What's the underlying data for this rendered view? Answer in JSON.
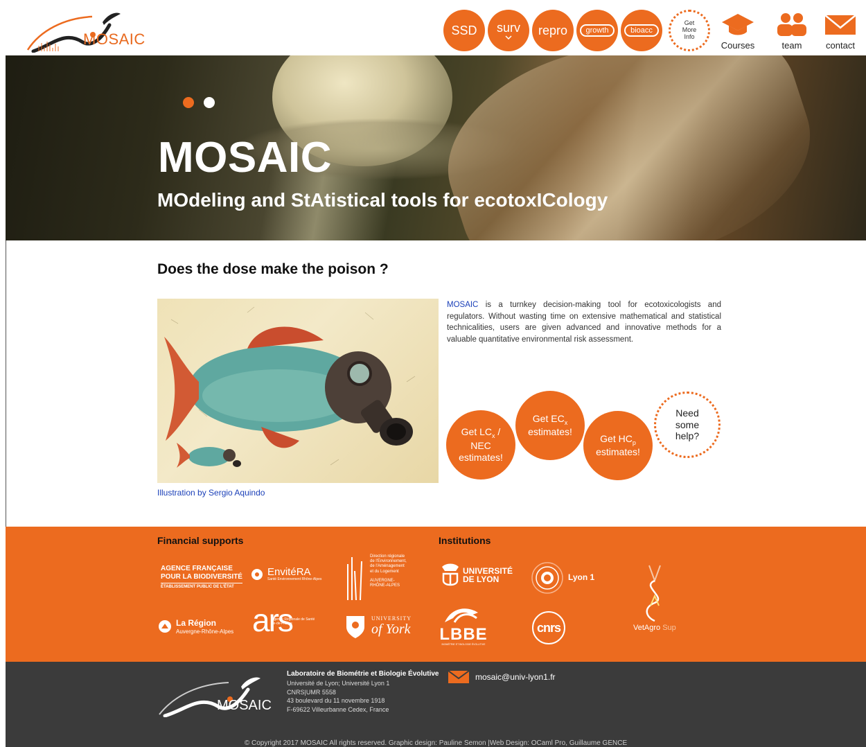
{
  "brand": {
    "logo_text": "MOSAIC",
    "accent_color": "#ec6b1f",
    "logo_icon": "mosaic-logo"
  },
  "nav": {
    "items": [
      {
        "label": "SSD"
      },
      {
        "label": "surv"
      },
      {
        "label": "repro"
      },
      {
        "label": "growth"
      },
      {
        "label": "bioacc"
      }
    ],
    "get_more_info": "Get More Info",
    "courses": {
      "label": "Courses",
      "icon": "mortarboard-icon"
    },
    "team": {
      "label": "team",
      "icon": "people-icon"
    },
    "contact": {
      "label": "contact",
      "icon": "envelope-icon"
    }
  },
  "hero": {
    "title": "MOSAIC",
    "subtitle": "MOdeling and StAtistical tools for ecotoxICology",
    "slides": 2,
    "active_slide": 1
  },
  "main": {
    "section_title": "Does the dose make the poison ?",
    "illustration_credit": "Illustration by Sergio Aquindo",
    "intro_highlight": "MOSAIC",
    "intro_text": " is a turnkey decision-making tool for ecotoxicologists and regulators. Without wasting time on extensive mathematical and statistical technicalities, users are given advanced and innovative methods for a valuable quantitative environmental risk assessment.",
    "cta": {
      "lc": {
        "line1": "Get LC",
        "sub": "x",
        "line2": " /",
        "line3": "NEC",
        "line4": "estimates!"
      },
      "ec": {
        "line1": "Get EC",
        "sub": "x",
        "line2": "estimates!"
      },
      "hc": {
        "line1": "Get HC",
        "sub": "p",
        "line2": "estimates!"
      },
      "help": "Need some help?"
    }
  },
  "supports": {
    "financial_heading": "Financial supports",
    "institutions_heading": "Institutions",
    "financial": {
      "afb": {
        "line1": "AGENCE FRANÇAISE",
        "line2": "POUR LA BIODIVERSITÉ",
        "line3": "ÉTABLISSEMENT PUBLIC DE L'ÉTAT"
      },
      "envitera": {
        "name": "EnvitéRA",
        "tagline": "Santé Environnement Rhône-Alpes"
      },
      "dreal": {
        "line1": "Direction régionale",
        "line2": "de l'Environnement,",
        "line3": "de l'Aménagement",
        "line4": "et du Logement",
        "line5": "AUVERGNE-",
        "line6": "RHÔNE-ALPES"
      },
      "region": {
        "name": "La Région",
        "sub": "Auvergne-Rhône-Alpes"
      },
      "ars": {
        "name": "ars",
        "sub": "Agence Régionale de Santé Île-de-France"
      },
      "york": {
        "line1": "UNIVERSITY",
        "line2": "of York"
      }
    },
    "institutions": {
      "udl": {
        "line1": "UNIVERSITÉ",
        "line2": "DE LYON"
      },
      "lyon1": {
        "name": "Lyon 1"
      },
      "lbbe": {
        "name": "LBBE",
        "sub": "BIOMÉTRIE ET BIOLOGIE ÉVOLUTIVE"
      },
      "cnrs": {
        "name": "cnrs"
      },
      "vetagro": {
        "name": "VetAgro",
        "sub": "Sup"
      }
    }
  },
  "footer": {
    "logo_text": "MOSAIC",
    "lab_name": "Laboratoire de Biométrie et Biologie Évolutive",
    "lines": [
      "Université de Lyon; Université Lyon 1",
      "CNRS|UMR 5558",
      "43 boulevard du 11 novembre 1918",
      "F-69622 Villeurbanne Cedex, France"
    ],
    "email": "mosaic@univ-lyon1.fr",
    "copyright": "© Copyright 2017 MOSAIC All rights reserved. Graphic design: Pauline Semon |Web Design: OCaml Pro, Guillaume GENCE"
  }
}
